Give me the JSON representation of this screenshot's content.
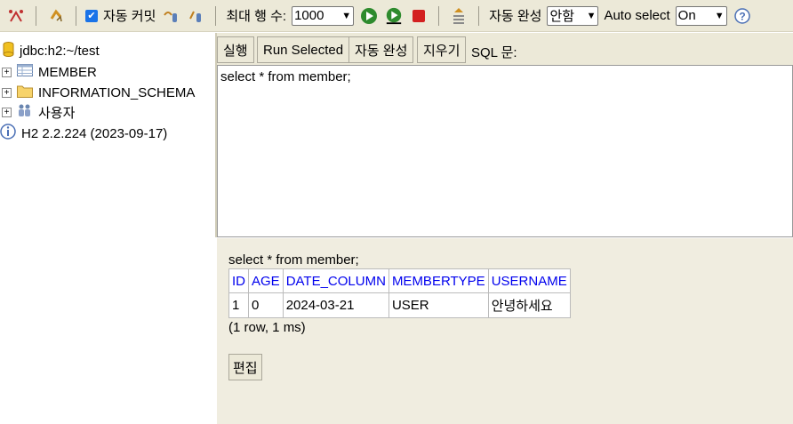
{
  "toolbar": {
    "autocommit_label": "자동 커밋",
    "max_rows_label": "최대 행 수:",
    "max_rows_value": "1000",
    "autocomplete_label": "자동 완성",
    "autocomplete_value": "안함",
    "autoselect_label": "Auto select",
    "autoselect_value": "On",
    "colors": {
      "green": "#2e8b2e",
      "red": "#d32020",
      "help": "#4a6fb5"
    }
  },
  "tree": {
    "connection": "jdbc:h2:~/test",
    "items": [
      {
        "label": "MEMBER",
        "icon": "table-icon"
      },
      {
        "label": "INFORMATION_SCHEMA",
        "icon": "folder-icon"
      },
      {
        "label": "사용자",
        "icon": "users-icon"
      }
    ],
    "version": "H2 2.2.224 (2023-09-17)"
  },
  "query": {
    "buttons": {
      "run": "실행",
      "run_selected": "Run Selected",
      "autocomplete": "자동 완성",
      "clear": "지우기"
    },
    "sql_label": "SQL 문:",
    "sql_text": "select * from member;"
  },
  "result": {
    "query_text": "select * from member;",
    "columns": [
      "ID",
      "AGE",
      "DATE_COLUMN",
      "MEMBERTYPE",
      "USERNAME"
    ],
    "rows": [
      [
        "1",
        "0",
        "2024-03-21",
        "USER",
        "안녕하세요"
      ]
    ],
    "summary": "(1 row, 1 ms)",
    "edit_label": "편집"
  }
}
